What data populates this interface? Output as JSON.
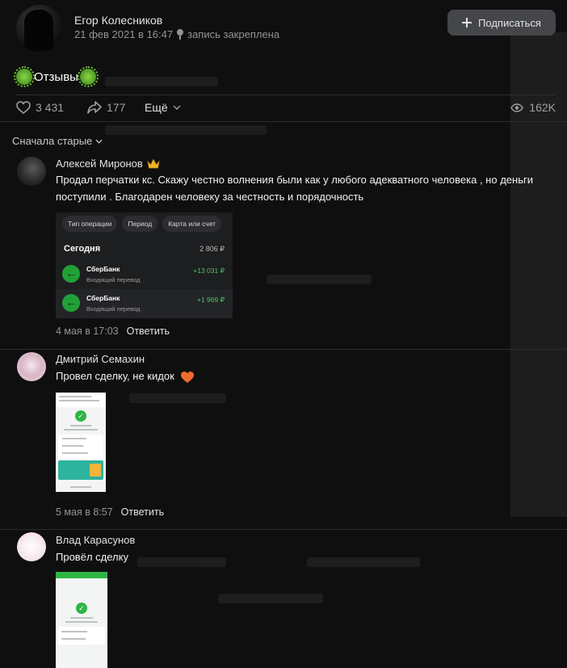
{
  "post": {
    "author": "Егор Колесников",
    "date": "21 фев 2021 в 16:47",
    "pinned_label": "запись закреплена",
    "subscribe_label": "Подписаться",
    "text": "Отзывы",
    "likes": "3 431",
    "shares": "177",
    "more_label": "Ещё",
    "views": "162K"
  },
  "sort_label": "Сначала старые",
  "comments": [
    {
      "author": "Алексей Миронов",
      "text": "Продал перчатки кс. Скажу честно волнения были как у любого адекватного человека , но деньги поступили . Благодарен человеку за честность и порядочность",
      "date": "4 мая в 17:03",
      "reply_label": "Ответить"
    },
    {
      "author": "Дмитрий Семахин",
      "text": "Провел сделку, не кидок",
      "date": "5 мая в 8:57",
      "reply_label": "Ответить"
    },
    {
      "author": "Влад Карасунов",
      "text": "Провёл сделку"
    }
  ],
  "bank_screenshot": {
    "filters": [
      "Тип операции",
      "Период",
      "Карта или счет"
    ],
    "day_label": "Сегодня",
    "day_total": "2 806 ₽",
    "transactions": [
      {
        "bank": "СберБанк",
        "type": "Входящий перевод",
        "amount": "+13 031 ₽"
      },
      {
        "bank": "СберБанк",
        "type": "Входящий перевод",
        "amount": "+1 969 ₽"
      }
    ]
  },
  "colors": {
    "background": "#0f0f10",
    "accent_button": "#45464a",
    "muted_text": "#939393",
    "sber_green": "#21a038"
  },
  "icons": [
    "pin-icon",
    "plus-icon",
    "virus-icon",
    "heart-icon",
    "share-icon",
    "chevron-down-icon",
    "eye-icon",
    "crown-icon",
    "heart-emoji-icon"
  ]
}
